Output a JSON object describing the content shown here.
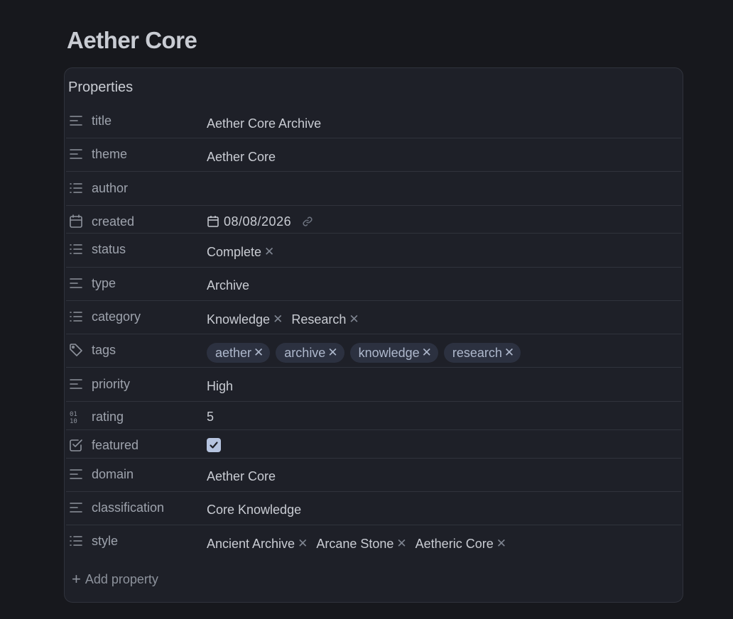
{
  "page": {
    "title": "Aether Core"
  },
  "panel": {
    "heading": "Properties",
    "add_label": "Add property"
  },
  "props": {
    "title": {
      "key": "title",
      "icon": "text-icon",
      "value": "Aether Core Archive"
    },
    "theme": {
      "key": "theme",
      "icon": "text-icon",
      "value": "Aether Core"
    },
    "author": {
      "key": "author",
      "icon": "list-icon",
      "value": ""
    },
    "created": {
      "key": "created",
      "icon": "calendar-icon",
      "value": "08/08/2026"
    },
    "status": {
      "key": "status",
      "icon": "list-icon",
      "values": [
        "Complete"
      ]
    },
    "type": {
      "key": "type",
      "icon": "text-icon",
      "value": "Archive"
    },
    "category": {
      "key": "category",
      "icon": "list-icon",
      "values": [
        "Knowledge",
        "Research"
      ]
    },
    "tags": {
      "key": "tags",
      "icon": "tag-icon",
      "values": [
        "aether",
        "archive",
        "knowledge",
        "research"
      ]
    },
    "priority": {
      "key": "priority",
      "icon": "text-icon",
      "value": "High"
    },
    "rating": {
      "key": "rating",
      "icon": "number-icon",
      "value": "5"
    },
    "featured": {
      "key": "featured",
      "icon": "checkbox-icon",
      "checked": true
    },
    "domain": {
      "key": "domain",
      "icon": "text-icon",
      "value": "Aether Core"
    },
    "classification": {
      "key": "classification",
      "icon": "text-icon",
      "value": "Core Knowledge"
    },
    "style": {
      "key": "style",
      "icon": "list-icon",
      "values": [
        "Ancient Archive",
        "Arcane Stone",
        "Aetheric Core"
      ]
    }
  },
  "colors": {
    "background": "#17181d",
    "panel": "#1e2028",
    "tag_bg": "#2c3140",
    "checkbox": "#b6c4e0"
  }
}
